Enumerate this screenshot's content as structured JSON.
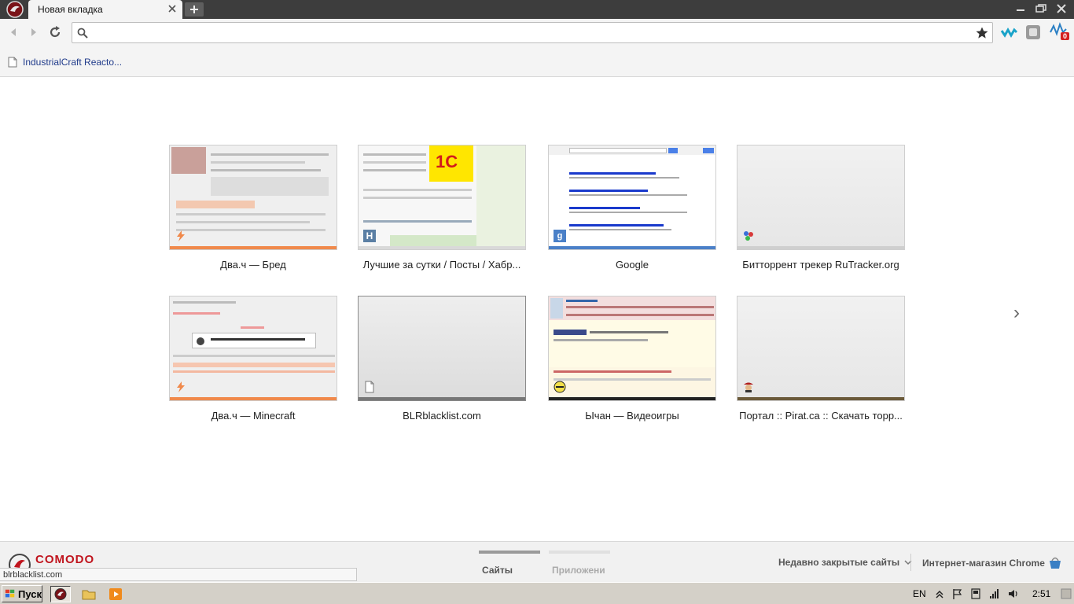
{
  "browser": {
    "tab_title": "Новая вкладка",
    "address_value": "",
    "extension_badge": "0"
  },
  "bookmarks": [
    {
      "label": "IndustrialCraft Reacto..."
    }
  ],
  "tiles": [
    {
      "label": "Два.ч — Бред",
      "bar_color": "#f0894b"
    },
    {
      "label": "Лучшие за сутки / Посты / Хабр...",
      "bar_color": "#d9d9d9"
    },
    {
      "label": "Google",
      "bar_color": "#4a80c8"
    },
    {
      "label": "Битторрент трекер RuTracker.org",
      "bar_color": "#cfcfcf"
    },
    {
      "label": "Два.ч — Minecraft",
      "bar_color": "#f0894b"
    },
    {
      "label": "BLRblacklist.com",
      "bar_color": "#777777"
    },
    {
      "label": "Ычан — Видеоигры",
      "bar_color": "#222222"
    },
    {
      "label": "Портал :: Pirat.ca :: Скачать торр...",
      "bar_color": "#6b5a3a"
    }
  ],
  "footer": {
    "brand": "COMODO",
    "tab_sites": "Сайты",
    "tab_apps": "Приложени",
    "recent_closed": "Недавно закрытые сайты",
    "web_store": "Интернет-магазин Chrome"
  },
  "status_url": "blrblacklist.com",
  "taskbar": {
    "start_label": "Пуск",
    "lang": "EN",
    "clock": "2:51"
  },
  "colors": {
    "accent_orange": "#f0894b",
    "comodo_red": "#c0141d",
    "tab_active_bar": "#9a9a9a"
  }
}
